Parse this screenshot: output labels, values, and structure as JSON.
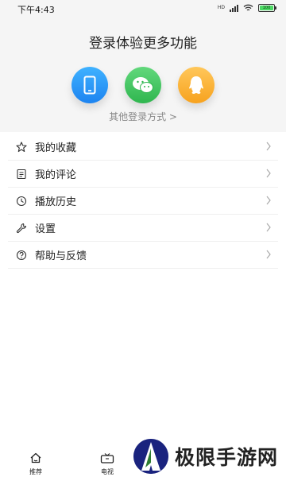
{
  "status_bar": {
    "time": "下午4:43",
    "network": "HD",
    "battery": "100"
  },
  "login": {
    "title": "登录体验更多功能",
    "buttons": [
      {
        "icon": "phone-icon"
      },
      {
        "icon": "wechat-icon"
      },
      {
        "icon": "qq-icon"
      }
    ],
    "other_methods": "其他登录方式 >"
  },
  "menu": {
    "items": [
      {
        "label": "我的收藏",
        "icon": "star-icon"
      },
      {
        "label": "我的评论",
        "icon": "comment-icon"
      },
      {
        "label": "播放历史",
        "icon": "clock-icon"
      },
      {
        "label": "设置",
        "icon": "wrench-icon"
      },
      {
        "label": "帮助与反馈",
        "icon": "help-icon"
      }
    ]
  },
  "bottom_nav": {
    "items": [
      {
        "label": "推荐",
        "icon": "home-icon"
      },
      {
        "label": "电视",
        "icon": "tv-icon"
      }
    ]
  },
  "watermark": {
    "text": "极限手游网"
  },
  "colors": {
    "phone": "#1d84f0",
    "wechat": "#2fb64f",
    "qq": "#f7a21e",
    "logo": "#1a237e"
  }
}
